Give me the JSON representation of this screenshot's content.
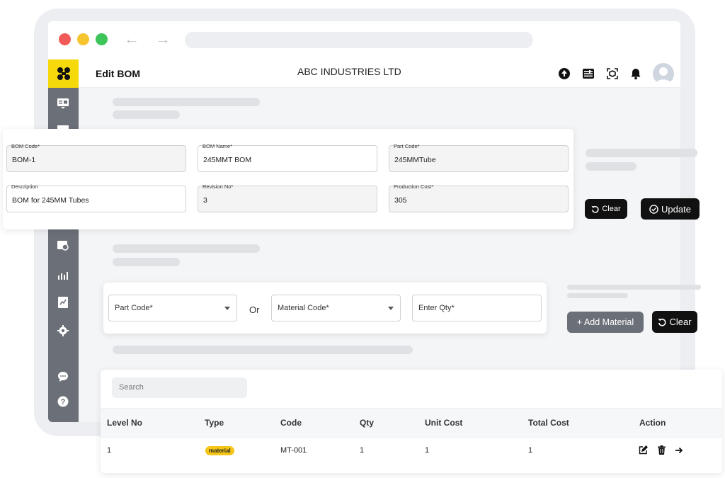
{
  "header": {
    "page_title": "Edit BOM",
    "company_name": "ABC INDUSTRIES LTD",
    "icons": [
      "upload-icon",
      "list-settings-icon",
      "scan-icon",
      "bell-icon",
      "avatar"
    ]
  },
  "bom_form": {
    "bom_code": {
      "label": "BOM Code*",
      "value": "BOM-1"
    },
    "bom_name": {
      "label": "BOM Name*",
      "value": "245MMT BOM"
    },
    "part_code": {
      "label": "Part Code*",
      "value": "245MMTube"
    },
    "description": {
      "label": "Description",
      "value": "BOM for 245MM Tubes"
    },
    "revision_no": {
      "label": "Revision No*",
      "value": "3"
    },
    "production_cost": {
      "label": "Production Cost*",
      "value": "305"
    }
  },
  "actions": {
    "clear_label": "Clear",
    "update_label": "Update"
  },
  "material_form": {
    "part_code_placeholder": "Part Code*",
    "or_label": "Or",
    "material_code_placeholder": "Material Code*",
    "qty_placeholder": "Enter Qty*",
    "add_material_label": "+ Add Material",
    "clear_label": "Clear"
  },
  "table": {
    "search_placeholder": "Search",
    "headers": [
      "Level No",
      "Type",
      "Code",
      "Qty",
      "Unit Cost",
      "Total Cost",
      "Action"
    ],
    "rows": [
      {
        "level_no": "1",
        "type": "material",
        "code": "MT-001",
        "qty": "1",
        "unit_cost": "1",
        "total_cost": "1"
      }
    ]
  },
  "colors": {
    "accent_yellow": "#f5d90a",
    "sidebar": "#6b6f77",
    "button_dark": "#111111",
    "button_grey": "#6b6f77",
    "badge": "#f5c518"
  }
}
